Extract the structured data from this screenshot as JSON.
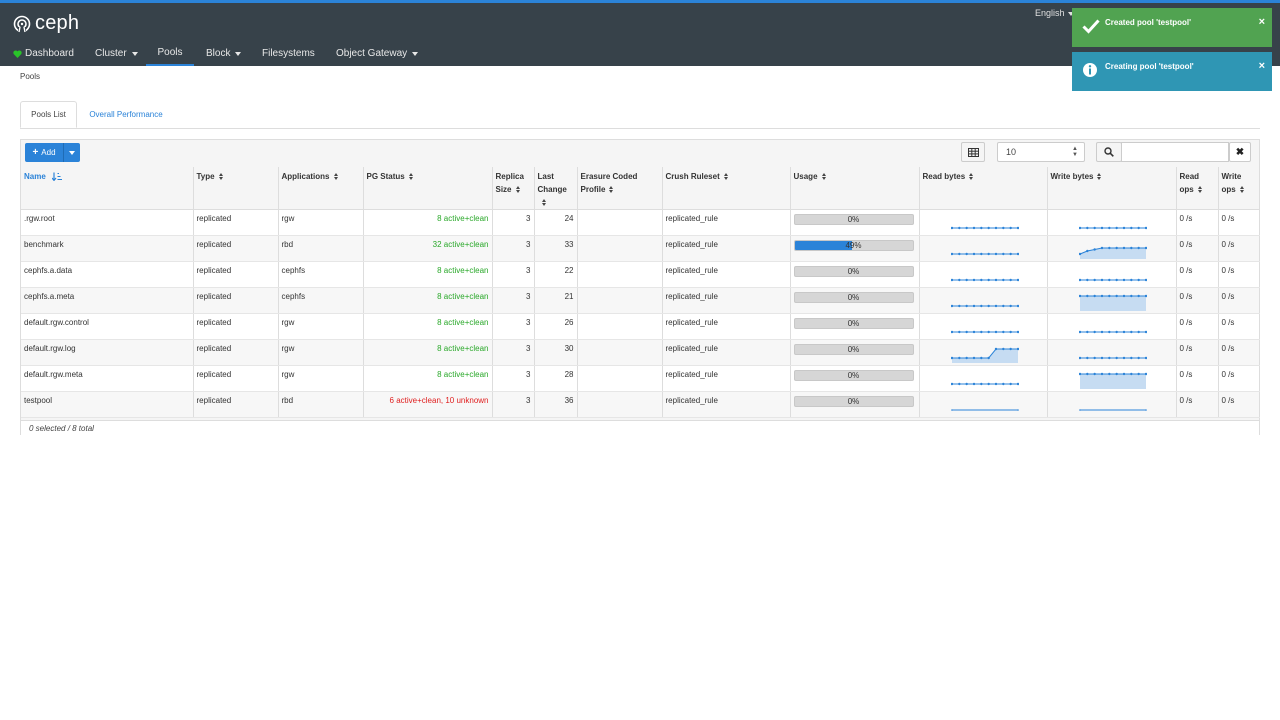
{
  "header": {
    "brand": "ceph",
    "language": "English",
    "nav": [
      {
        "label": "Dashboard",
        "dropdown": false,
        "active": false
      },
      {
        "label": "Cluster",
        "dropdown": true,
        "active": false
      },
      {
        "label": "Pools",
        "dropdown": false,
        "active": true
      },
      {
        "label": "Block",
        "dropdown": true,
        "active": false
      },
      {
        "label": "Filesystems",
        "dropdown": false,
        "active": false
      },
      {
        "label": "Object Gateway",
        "dropdown": true,
        "active": false
      }
    ]
  },
  "breadcrumb": "Pools",
  "tabs": [
    {
      "label": "Pools List",
      "active": true
    },
    {
      "label": "Overall Performance",
      "active": false
    }
  ],
  "toolbar": {
    "add_label": "Add",
    "page_size": "10",
    "search_value": ""
  },
  "table": {
    "columns": [
      {
        "label": "Name",
        "sorted": true
      },
      {
        "label": "Type",
        "sorted": false
      },
      {
        "label": "Applications",
        "sorted": false
      },
      {
        "label": "PG Status",
        "sorted": false
      },
      {
        "label": "Replica Size",
        "sorted": false
      },
      {
        "label": "Last Change",
        "sorted": false
      },
      {
        "label": "Erasure Coded Profile",
        "sorted": false
      },
      {
        "label": "Crush Ruleset",
        "sorted": false
      },
      {
        "label": "Usage",
        "sorted": false
      },
      {
        "label": "Read bytes",
        "sorted": false
      },
      {
        "label": "Write bytes",
        "sorted": false
      },
      {
        "label": "Read ops",
        "sorted": false
      },
      {
        "label": "Write ops",
        "sorted": false
      }
    ],
    "rows": [
      {
        "name": ".rgw.root",
        "type": "replicated",
        "app": "rgw",
        "pg": "8 active+clean",
        "pg_ok": true,
        "replica": "3",
        "last_change": "24",
        "ec_profile": "",
        "crush": "replicated_rule",
        "usage": 0,
        "usage_label": "0%",
        "read_ops": "0 /s",
        "write_ops": "0 /s",
        "read_trend": [
          0,
          0,
          0,
          0,
          0,
          0,
          0,
          0,
          0,
          0
        ],
        "write_trend": [
          0,
          0,
          0,
          0,
          0,
          0,
          0,
          0,
          0,
          0
        ]
      },
      {
        "name": "benchmark",
        "type": "replicated",
        "app": "rbd",
        "pg": "32 active+clean",
        "pg_ok": true,
        "replica": "3",
        "last_change": "33",
        "ec_profile": "",
        "crush": "replicated_rule",
        "usage": 49,
        "usage_label": "49%",
        "read_ops": "0 /s",
        "write_ops": "0 /s",
        "read_trend": [
          0,
          0,
          0,
          0,
          0,
          0,
          0,
          0,
          0,
          0
        ],
        "write_trend": [
          0,
          0.3,
          0.45,
          0.6,
          0.6,
          0.6,
          0.6,
          0.6,
          0.6,
          0.6
        ]
      },
      {
        "name": "cephfs.a.data",
        "type": "replicated",
        "app": "cephfs",
        "pg": "8 active+clean",
        "pg_ok": true,
        "replica": "3",
        "last_change": "22",
        "ec_profile": "",
        "crush": "replicated_rule",
        "usage": 0,
        "usage_label": "0%",
        "read_ops": "0 /s",
        "write_ops": "0 /s",
        "read_trend": [
          0,
          0,
          0,
          0,
          0,
          0,
          0,
          0,
          0,
          0
        ],
        "write_trend": [
          0,
          0,
          0,
          0,
          0,
          0,
          0,
          0,
          0,
          0
        ]
      },
      {
        "name": "cephfs.a.meta",
        "type": "replicated",
        "app": "cephfs",
        "pg": "8 active+clean",
        "pg_ok": true,
        "replica": "3",
        "last_change": "21",
        "ec_profile": "",
        "crush": "replicated_rule",
        "usage": 0,
        "usage_label": "0%",
        "read_ops": "0 /s",
        "write_ops": "0 /s",
        "read_trend": [
          0,
          0,
          0,
          0,
          0,
          0,
          0,
          0,
          0,
          0
        ],
        "write_trend": [
          1,
          1,
          1,
          1,
          1,
          1,
          1,
          1,
          1,
          1
        ]
      },
      {
        "name": "default.rgw.control",
        "type": "replicated",
        "app": "rgw",
        "pg": "8 active+clean",
        "pg_ok": true,
        "replica": "3",
        "last_change": "26",
        "ec_profile": "",
        "crush": "replicated_rule",
        "usage": 0,
        "usage_label": "0%",
        "read_ops": "0 /s",
        "write_ops": "0 /s",
        "read_trend": [
          0,
          0,
          0,
          0,
          0,
          0,
          0,
          0,
          0,
          0
        ],
        "write_trend": [
          0,
          0,
          0,
          0,
          0,
          0,
          0,
          0,
          0,
          0
        ]
      },
      {
        "name": "default.rgw.log",
        "type": "replicated",
        "app": "rgw",
        "pg": "8 active+clean",
        "pg_ok": true,
        "replica": "3",
        "last_change": "30",
        "ec_profile": "",
        "crush": "replicated_rule",
        "usage": 0,
        "usage_label": "0%",
        "read_ops": "0 /s",
        "write_ops": "0 /s",
        "read_trend": [
          0,
          0,
          0,
          0,
          0,
          0,
          0.9,
          0.9,
          0.9,
          0.9
        ],
        "write_trend": [
          0,
          0,
          0,
          0,
          0,
          0,
          0,
          0,
          0,
          0
        ]
      },
      {
        "name": "default.rgw.meta",
        "type": "replicated",
        "app": "rgw",
        "pg": "8 active+clean",
        "pg_ok": true,
        "replica": "3",
        "last_change": "28",
        "ec_profile": "",
        "crush": "replicated_rule",
        "usage": 0,
        "usage_label": "0%",
        "read_ops": "0 /s",
        "write_ops": "0 /s",
        "read_trend": [
          0,
          0,
          0,
          0,
          0,
          0,
          0,
          0,
          0,
          0
        ],
        "write_trend": [
          1,
          1,
          1,
          1,
          1,
          1,
          1,
          1,
          1,
          1
        ]
      },
      {
        "name": "testpool",
        "type": "replicated",
        "app": "rbd",
        "pg": "6 active+clean, 10 unknown",
        "pg_ok": false,
        "replica": "3",
        "last_change": "36",
        "ec_profile": "",
        "crush": "replicated_rule",
        "usage": 0,
        "usage_label": "0%",
        "read_ops": "0 /s",
        "write_ops": "0 /s",
        "read_trend": [
          0,
          0
        ],
        "write_trend": [
          0,
          0
        ]
      }
    ],
    "footer": "0 selected / 8 total"
  },
  "toasts": [
    {
      "kind": "success",
      "message": "Created pool 'testpool'"
    },
    {
      "kind": "info",
      "message": "Creating pool 'testpool'"
    }
  ],
  "colors": {
    "accent": "#2b83d8",
    "nav_bg": "#37424a",
    "ok": "#29a829",
    "bad": "#e02020",
    "success": "#51a351",
    "info": "#2f96b4"
  }
}
